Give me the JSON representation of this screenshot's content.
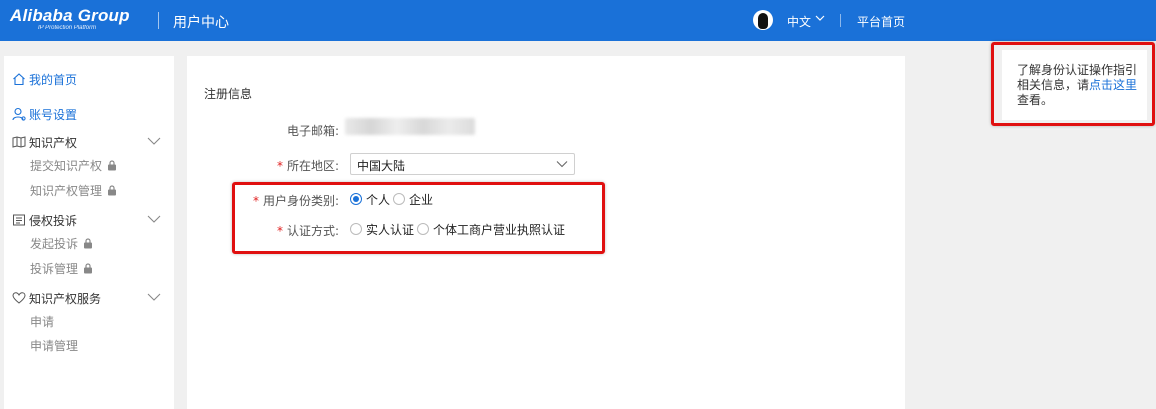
{
  "header": {
    "logo_text": "Alibaba Group",
    "logo_sub": "IP Protection Platform",
    "title": "用户中心",
    "language": "中文",
    "platform_home": "平台首页"
  },
  "sidebar": {
    "items": [
      {
        "label": "我的首页",
        "icon": "home-icon"
      },
      {
        "label": "账号设置",
        "icon": "user-icon"
      },
      {
        "label": "知识产权",
        "icon": "book-icon",
        "children": [
          "提交知识产权",
          "知识产权管理"
        ]
      },
      {
        "label": "侵权投诉",
        "icon": "report-icon",
        "children": [
          "发起投诉",
          "投诉管理"
        ]
      },
      {
        "label": "知识产权服务",
        "icon": "heart-icon",
        "children": [
          "申请",
          "申请管理"
        ]
      }
    ]
  },
  "form": {
    "section_title": "注册信息",
    "email_label": "电子邮箱:",
    "region_label": "所在地区:",
    "region_value": "中国大陆",
    "identity_label": "用户身份类别:",
    "identity_options": [
      "个人",
      "企业"
    ],
    "identity_selected": "个人",
    "auth_label": "认证方式:",
    "auth_options": [
      "实人认证",
      "个体工商户营业执照认证"
    ]
  },
  "tip": {
    "text_before": "了解身份认证操作指引相关信息，请",
    "link": "点击这里",
    "text_after": "查看。"
  },
  "colors": {
    "header_bg": "#1a71d8",
    "accent": "#1a71d8",
    "annotation": "#e01010"
  }
}
